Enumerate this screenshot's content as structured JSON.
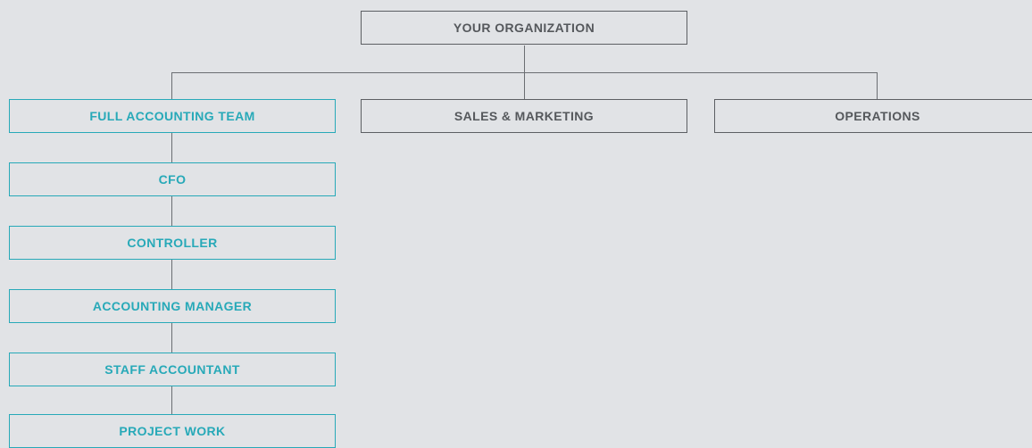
{
  "colors": {
    "background": "#e1e3e6",
    "accent": "#27a9b8",
    "neutral": "#55585c",
    "connector": "#6b6e72"
  },
  "root": {
    "label": "YOUR ORGANIZATION"
  },
  "departments": [
    {
      "label": "FULL ACCOUNTING TEAM",
      "highlighted": true
    },
    {
      "label": "SALES & MARKETING",
      "highlighted": false
    },
    {
      "label": "OPERATIONS",
      "highlighted": false
    }
  ],
  "accounting_chain": [
    {
      "label": "CFO"
    },
    {
      "label": "CONTROLLER"
    },
    {
      "label": "ACCOUNTING MANAGER"
    },
    {
      "label": "STAFF ACCOUNTANT"
    },
    {
      "label": "PROJECT WORK"
    }
  ]
}
